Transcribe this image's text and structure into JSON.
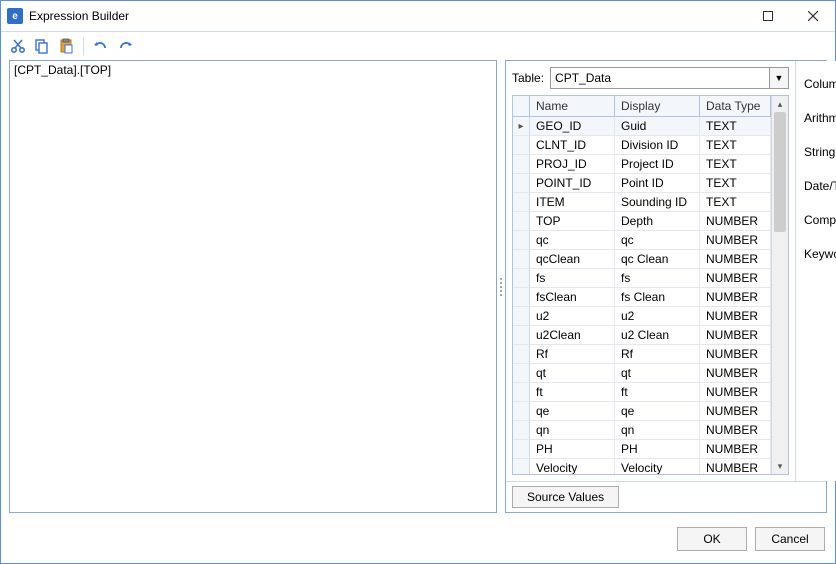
{
  "window": {
    "title": "Expression Builder",
    "app_icon_letter": "e"
  },
  "toolbar": {
    "cut_tip": "Cut",
    "copy_tip": "Copy",
    "paste_tip": "Paste",
    "undo_tip": "Undo",
    "redo_tip": "Redo"
  },
  "expression": "[CPT_Data].[TOP]",
  "right": {
    "table_label": "Table:",
    "table_value": "CPT_Data",
    "grid": {
      "col_name": "Name",
      "col_display": "Display",
      "col_datatype": "Data Type",
      "selected_index": 0,
      "rows": [
        {
          "name": "GEO_ID",
          "display": "Guid",
          "datatype": "TEXT"
        },
        {
          "name": "CLNT_ID",
          "display": "Division ID",
          "datatype": "TEXT"
        },
        {
          "name": "PROJ_ID",
          "display": "Project ID",
          "datatype": "TEXT"
        },
        {
          "name": "POINT_ID",
          "display": "Point ID",
          "datatype": "TEXT"
        },
        {
          "name": "ITEM",
          "display": "Sounding ID",
          "datatype": "TEXT"
        },
        {
          "name": "TOP",
          "display": "Depth",
          "datatype": "NUMBER"
        },
        {
          "name": "qc",
          "display": "qc",
          "datatype": "NUMBER"
        },
        {
          "name": "qcClean",
          "display": "qc Clean",
          "datatype": "NUMBER"
        },
        {
          "name": "fs",
          "display": "fs",
          "datatype": "NUMBER"
        },
        {
          "name": "fsClean",
          "display": "fs Clean",
          "datatype": "NUMBER"
        },
        {
          "name": "u2",
          "display": "u2",
          "datatype": "NUMBER"
        },
        {
          "name": "u2Clean",
          "display": "u2 Clean",
          "datatype": "NUMBER"
        },
        {
          "name": "Rf",
          "display": "Rf",
          "datatype": "NUMBER"
        },
        {
          "name": "qt",
          "display": "qt",
          "datatype": "NUMBER"
        },
        {
          "name": "ft",
          "display": "ft",
          "datatype": "NUMBER"
        },
        {
          "name": "qe",
          "display": "qe",
          "datatype": "NUMBER"
        },
        {
          "name": "qn",
          "display": "qn",
          "datatype": "NUMBER"
        },
        {
          "name": "PH",
          "display": "PH",
          "datatype": "NUMBER"
        },
        {
          "name": "Velocity",
          "display": "Velocity",
          "datatype": "NUMBER"
        }
      ]
    },
    "source_values": "Source Values",
    "categories": [
      "Columns",
      "Arithmetic",
      "String",
      "Date/Time",
      "Comparison",
      "Keyword"
    ]
  },
  "footer": {
    "ok": "OK",
    "cancel": "Cancel"
  }
}
